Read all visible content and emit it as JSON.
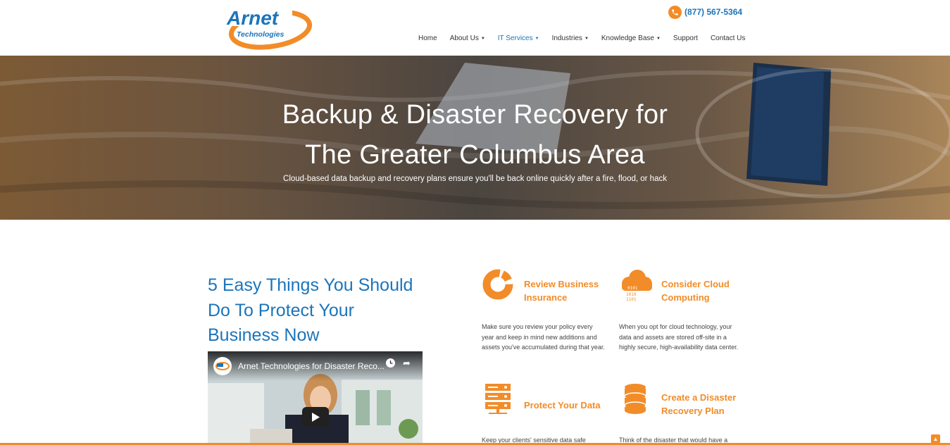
{
  "header": {
    "logo_text_main": "Arnet",
    "logo_text_sub": "Technologies",
    "phone": "(877) 567-5364",
    "nav": [
      {
        "label": "Home",
        "has_dropdown": false,
        "active": false
      },
      {
        "label": "About Us",
        "has_dropdown": true,
        "active": false
      },
      {
        "label": "IT Services",
        "has_dropdown": true,
        "active": true
      },
      {
        "label": "Industries",
        "has_dropdown": true,
        "active": false
      },
      {
        "label": "Knowledge Base",
        "has_dropdown": true,
        "active": false
      },
      {
        "label": "Support",
        "has_dropdown": false,
        "active": false
      },
      {
        "label": "Contact Us",
        "has_dropdown": false,
        "active": false
      }
    ]
  },
  "hero": {
    "title_line1": "Backup & Disaster Recovery for",
    "title_line2": "The Greater Columbus Area",
    "subtitle": "Cloud-based data backup and recovery plans ensure you'll be back online quickly after a fire, flood, or hack"
  },
  "main": {
    "heading": "5 Easy Things You Should Do To Protect Your Business Now",
    "video": {
      "title": "Arnet Technologies for Disaster Reco...",
      "icons": [
        "clock-icon",
        "share-icon",
        "play-icon"
      ]
    },
    "features": [
      {
        "icon": "donut-chart-icon",
        "title": "Review Business Insurance",
        "desc": "Make sure you review your policy every year and keep in mind new additions and assets you've accumulated during that year."
      },
      {
        "icon": "cloud-binary-icon",
        "title": "Consider Cloud Computing",
        "desc": "When you opt for cloud technology, your data and assets are stored off-site in a highly secure, high-availability data center."
      },
      {
        "icon": "server-icon",
        "title": "Protect Your Data",
        "desc": "Keep your clients' sensitive data safe"
      },
      {
        "icon": "database-icon",
        "title": "Create a Disaster Recovery Plan",
        "desc": "Think of the disaster that would have a"
      }
    ]
  },
  "colors": {
    "accent_orange": "#f28c28",
    "brand_blue": "#1b75bb"
  }
}
